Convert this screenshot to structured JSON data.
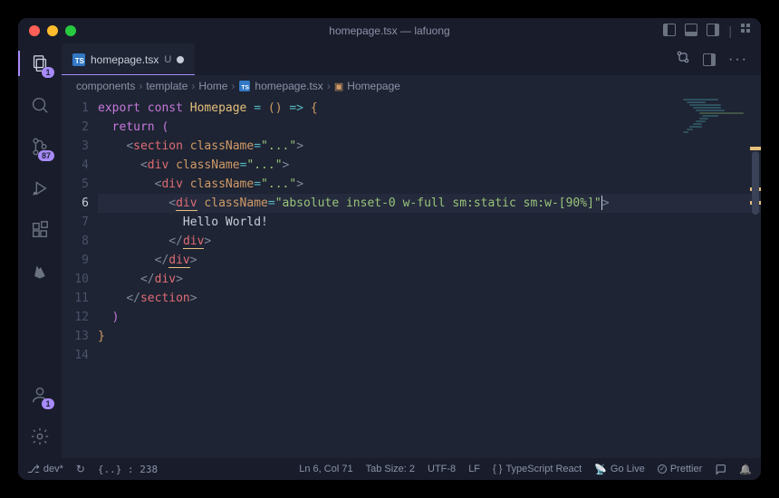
{
  "window": {
    "title": "homepage.tsx — lafuong"
  },
  "tab": {
    "filename": "homepage.tsx",
    "modifiedFlag": "U"
  },
  "breadcrumb": {
    "parts": [
      "components",
      "template",
      "Home",
      "homepage.tsx",
      "Homepage"
    ]
  },
  "activitybar": {
    "explorerBadge": "1",
    "scmBadge": "87",
    "accountBadge": "1"
  },
  "code": {
    "lines": [
      1,
      2,
      3,
      4,
      5,
      6,
      7,
      8,
      9,
      10,
      11,
      12,
      13,
      14
    ],
    "activeLine": 6,
    "tokens": {
      "l1": {
        "export": "export",
        "const": "const",
        "Homepage": "Homepage",
        "eq": " = ",
        "paren": "()",
        "arrow": " => ",
        "brace": "{"
      },
      "l2": {
        "return": "return",
        "paren": "("
      },
      "l3": {
        "tag": "section",
        "attr": "className",
        "val": "\"...\""
      },
      "l4": {
        "tag": "div",
        "attr": "className",
        "val": "\"...\""
      },
      "l5": {
        "tag": "div",
        "attr": "className",
        "val": "\"...\""
      },
      "l6": {
        "tag": "div",
        "attr": "className",
        "val": "\"absolute inset-0 w-full sm:static sm:w-[90%]\""
      },
      "l7": {
        "text": "Hello World!"
      },
      "l8": {
        "tag": "div"
      },
      "l9": {
        "tag": "div"
      },
      "l10": {
        "tag": "div"
      },
      "l11": {
        "tag": "section"
      },
      "l12": {
        "paren": ")"
      },
      "l13": {
        "brace": "}"
      }
    }
  },
  "status": {
    "branch": "dev*",
    "problems": "{..} : 238",
    "cursor": "Ln 6, Col 71",
    "tabSize": "Tab Size: 2",
    "encoding": "UTF-8",
    "eol": "LF",
    "lang": "TypeScript React",
    "goLive": "Go Live",
    "prettier": "Prettier"
  }
}
